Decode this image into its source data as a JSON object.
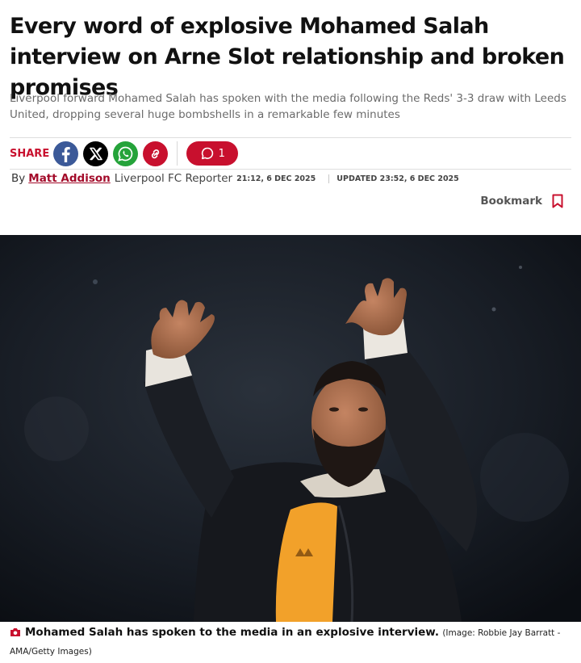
{
  "article": {
    "headline": "Every word of explosive Mohamed Salah interview on Arne Slot relationship and broken promises",
    "standfirst": "Liverpool forward Mohamed Salah has spoken with the media following the Reds' 3-3 draw with Leeds United, dropping several huge bombshells in a remarkable few minutes"
  },
  "share": {
    "label": "SHARE",
    "icons": [
      "facebook-icon",
      "x-icon",
      "whatsapp-icon",
      "copy-link-icon"
    ],
    "comment_count": "1"
  },
  "byline": {
    "prefix": "By",
    "author": "Matt Addison",
    "role": "Liverpool FC Reporter",
    "published": "21:12, 6 DEC 2025",
    "updated": "UPDATED  23:52, 6 DEC 2025"
  },
  "bookmark": {
    "label": "Bookmark"
  },
  "image": {
    "caption": "Mohamed Salah has spoken to the media in an explosive interview.",
    "credit": "(Image: Robbie Jay Barratt - AMA/Getty Images)"
  },
  "colors": {
    "accent": "#c8102e",
    "author": "#a30b2a",
    "facebook": "#3b5998",
    "whatsapp": "#25a33a"
  }
}
